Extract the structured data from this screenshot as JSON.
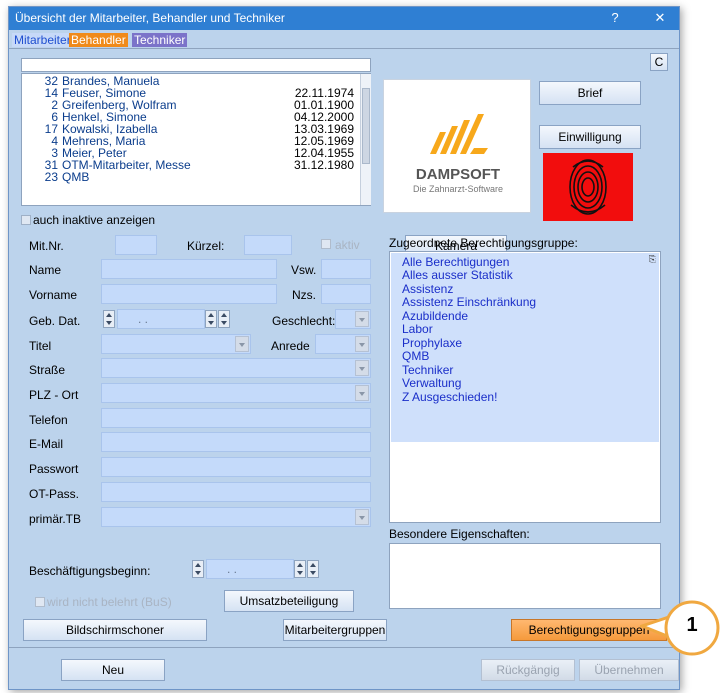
{
  "window": {
    "title": "Übersicht der Mitarbeiter, Behandler und Techniker",
    "help": "?",
    "close": "✕"
  },
  "tabs": [
    {
      "label": "Mitarbeiter",
      "color": "#1f4fd0"
    },
    {
      "label": "Behandler",
      "color": "#f08a1a"
    },
    {
      "label": "Techniker",
      "color": "#7b73c9"
    }
  ],
  "c_button": "C",
  "employees": [
    {
      "num": "32",
      "name": "Brandes, Manuela",
      "date": ""
    },
    {
      "num": "14",
      "name": "Feuser, Simone",
      "date": "22.11.1974"
    },
    {
      "num": "2",
      "name": "Greifenberg, Wolfram",
      "date": "01.01.1900"
    },
    {
      "num": "6",
      "name": "Henkel, Simone",
      "date": "04.12.2000"
    },
    {
      "num": "17",
      "name": "Kowalski, Izabella",
      "date": "13.03.1969"
    },
    {
      "num": "4",
      "name": "Mehrens, Maria",
      "date": "12.05.1969"
    },
    {
      "num": "3",
      "name": "Meier, Peter",
      "date": "12.04.1955"
    },
    {
      "num": "31",
      "name": "OTM-Mitarbeiter, Messe",
      "date": "31.12.1980"
    },
    {
      "num": "23",
      "name": "QMB",
      "date": ""
    }
  ],
  "logo": {
    "brand": "DAMPSOFT",
    "tagline": "Die Zahnarzt-Software"
  },
  "buttons": {
    "brief": "Brief",
    "einwilligung": "Einwilligung",
    "kamera": "Kamera",
    "umsatz": "Umsatzbeteiligung",
    "bildschirm": "Bildschirmschoner",
    "mitarbeitergruppen": "Mitarbeitergruppen",
    "berechtigungsgruppen": "Berechtigungsgruppen",
    "neu": "Neu",
    "rueck": "Rückgängig",
    "uebernehmen": "Übernehmen"
  },
  "inactive_label": "auch inaktive anzeigen",
  "form": {
    "mitnr": "Mit.Nr.",
    "kuerzel": "Kürzel:",
    "aktiv": "aktiv",
    "name": "Name",
    "vsw": "Vsw.",
    "vorname": "Vorname",
    "nzs": "Nzs.",
    "gebdat": "Geb. Dat.",
    "gebdat_value": ". .",
    "geschlecht": "Geschlecht:",
    "titel": "Titel",
    "anrede": "Anrede",
    "strasse": "Straße",
    "plz": "PLZ - Ort",
    "telefon": "Telefon",
    "email": "E-Mail",
    "passwort": "Passwort",
    "otpass": "OT-Pass.",
    "primaer": "primär.TB",
    "beschaeftigung": "Beschäftigungsbeginn:",
    "beschaeftigung_value": ". .",
    "belehrt": "wird nicht belehrt (BuS)"
  },
  "groups_label": "Zugeordnete Berechtigungsgruppe:",
  "groups": [
    "Alle Berechtigungen",
    "Alles ausser Statistik",
    "Assistenz",
    "Assistenz Einschränkung",
    "Azubildende",
    "Labor",
    "Prophylaxe",
    "QMB",
    "Techniker",
    "Verwaltung",
    "Z Ausgeschieden!"
  ],
  "eigenschaften_label": "Besondere Eigenschaften:",
  "callout": "1",
  "accent": "#f0a840"
}
